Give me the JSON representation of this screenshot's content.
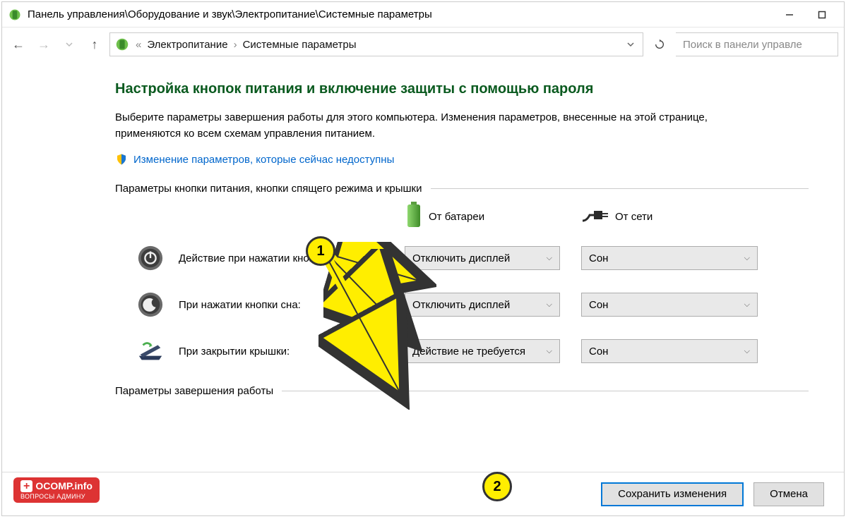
{
  "titlebar": {
    "path": "Панель управления\\Оборудование и звук\\Электропитание\\Системные параметры"
  },
  "breadcrumb": {
    "item1": "Электропитание",
    "item2": "Системные параметры"
  },
  "search": {
    "placeholder": "Поиск в панели управле"
  },
  "heading": "Настройка кнопок питания и включение защиты с помощью пароля",
  "description": "Выберите параметры завершения работы для этого компьютера. Изменения параметров, внесенные на этой странице, применяются ко всем схемам управления питанием.",
  "shield_link": "Изменение параметров, которые сейчас недоступны",
  "section1_label": "Параметры кнопки питания, кнопки спящего режима и крышки",
  "col_battery": "От батареи",
  "col_power": "От сети",
  "rows": {
    "power_button": "Действие при нажатии кнопки питания:",
    "sleep_button": "При нажатии кнопки сна:",
    "lid_close": "При закрытии крышки:"
  },
  "dropdowns": {
    "power_battery": "Отключить дисплей",
    "power_ac": "Сон",
    "sleep_battery": "Отключить дисплей",
    "sleep_ac": "Сон",
    "lid_battery": "Действие не требуется",
    "lid_ac": "Сон"
  },
  "section2_label": "Параметры завершения работы",
  "footer": {
    "save": "Сохранить изменения",
    "cancel": "Отмена"
  },
  "annotations": {
    "bubble1": "1",
    "bubble2": "2"
  },
  "watermark": {
    "main": "OCOMP.info",
    "sub": "ВОПРОСЫ АДМИНУ"
  }
}
